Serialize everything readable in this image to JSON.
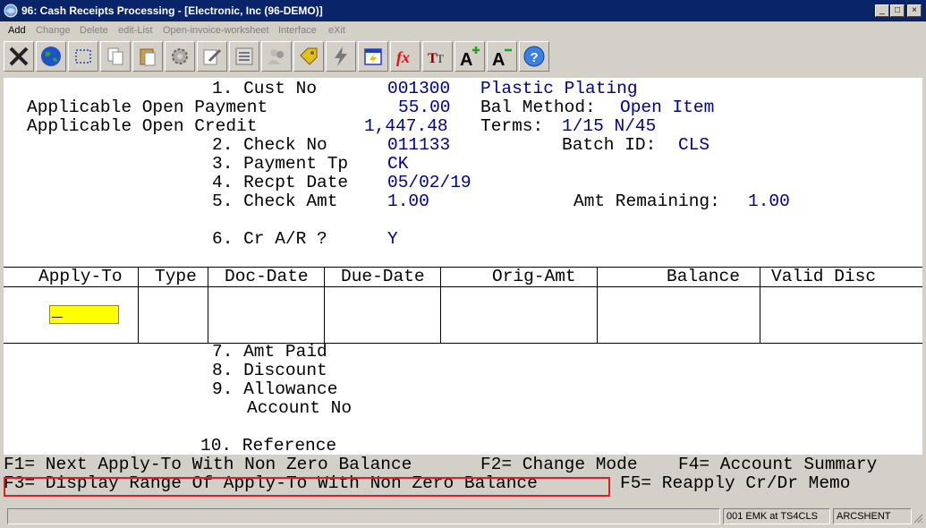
{
  "window": {
    "title": "96: Cash Receipts Processing - [Electronic, Inc (96-DEMO)]",
    "controls": {
      "minimize": "_",
      "restore": "□",
      "close": "×"
    }
  },
  "menu": [
    "Add",
    "Change",
    "Delete",
    "edit-List",
    "Open-invoice-worksheet",
    "Interface",
    "eXit"
  ],
  "toolbar": [
    "close-x-icon",
    "globe-icon",
    "select-rect-icon",
    "copy-icon",
    "paste-icon",
    "settings-gear-icon",
    "edit-pencil-icon",
    "list-icon",
    "people-icon",
    "tag-icon",
    "lightning-icon",
    "calendar-run-icon",
    "fx-function-icon",
    "font-tt-icon",
    "font-increase-icon",
    "font-decrease-icon",
    "help-icon"
  ],
  "form": {
    "cust_no_label": "1. Cust No",
    "cust_no": "001300",
    "cust_name": "Plastic Plating",
    "open_payment_label": "Applicable Open Payment",
    "open_payment": "55.00",
    "bal_method_label": "Bal Method:",
    "bal_method": "Open Item",
    "open_credit_label": "Applicable Open Credit",
    "open_credit": "1,447.48",
    "terms_label": "Terms:",
    "terms": "1/15 N/45",
    "check_no_label": "2. Check No",
    "check_no": "011133",
    "batch_id_label": "Batch ID:",
    "batch_id": "CLS",
    "payment_tp_label": "3. Payment Tp",
    "payment_tp": "CK",
    "recpt_date_label": "4. Recpt Date",
    "recpt_date": "05/02/19",
    "check_amt_label": "5. Check Amt",
    "check_amt": "1.00",
    "amt_remaining_label": "Amt Remaining:",
    "amt_remaining": "1.00",
    "cr_ar_label": "6. Cr A/R ?",
    "cr_ar": "Y"
  },
  "grid": {
    "headers": [
      "Apply-To",
      "Type",
      "Doc-Date",
      "Due-Date",
      "Orig-Amt",
      "Balance",
      "Valid Disc"
    ],
    "cursor": "_"
  },
  "lower": {
    "amt_paid_label": "7. Amt Paid",
    "discount_label": "8. Discount",
    "allowance_label": "9. Allowance",
    "account_no_label": "Account No",
    "reference_label": "10. Reference"
  },
  "fkeys": {
    "f1": "F1= Next Apply-To With Non Zero Balance",
    "f2": "F2= Change Mode",
    "f4": "F4= Account Summary",
    "f3": "F3= Display Range Of Apply-To With Non Zero Balance",
    "f5": "F5= Reapply Cr/Dr Memo"
  },
  "status": {
    "panel1": "",
    "panel2": "001 EMK at TS4CLS",
    "panel3": "ARCSHENT"
  }
}
